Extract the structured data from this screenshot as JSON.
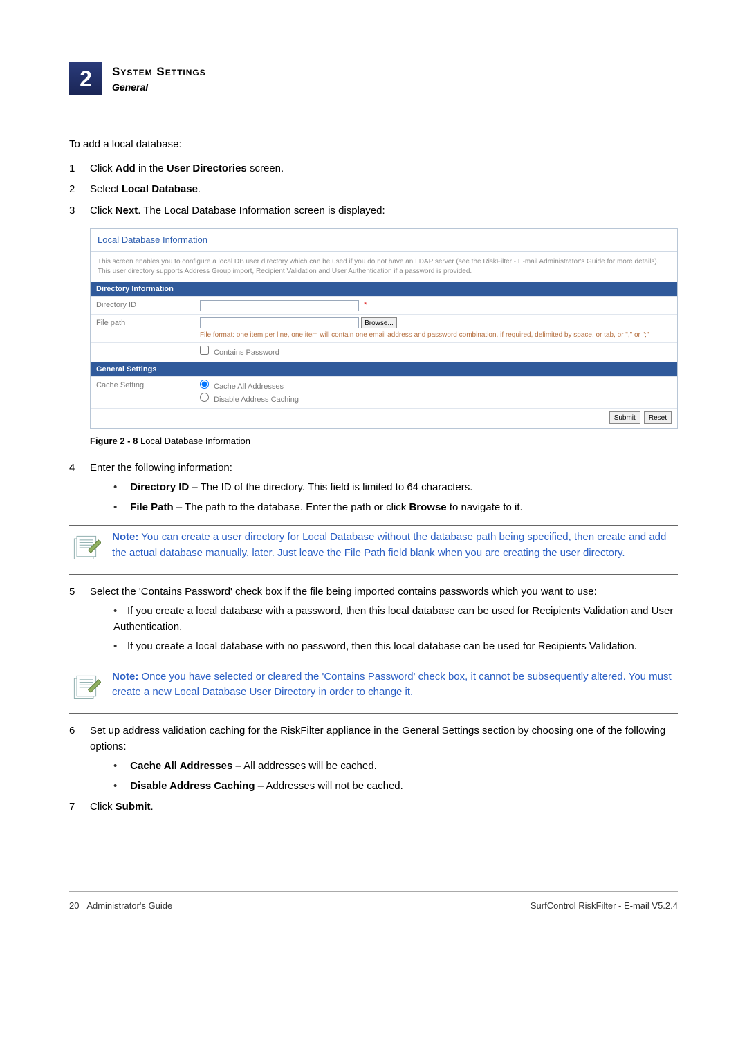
{
  "header": {
    "number": "2",
    "line1": "System Settings",
    "line2": "General"
  },
  "intro": "To add a local database:",
  "steps": {
    "s1": {
      "text_before": "Click ",
      "bold1": "Add",
      "mid": " in the ",
      "bold2": "User Directories",
      "after": " screen."
    },
    "s2": {
      "text_before": "Select ",
      "bold1": "Local Database",
      "after": "."
    },
    "s3": {
      "text_before": "Click ",
      "bold1": "Next",
      "after": ". The Local Database Information screen is displayed:"
    },
    "s4": {
      "text": "Enter the following information:"
    },
    "s5": {
      "text": "Select the 'Contains Password' check box if the file being imported contains passwords which you want to use:"
    },
    "s6": {
      "text": "Set up address validation caching for the RiskFilter appliance in the General Settings section by choosing one of the following options:"
    },
    "s7": {
      "text_before": "Click ",
      "bold1": "Submit",
      "after": "."
    }
  },
  "ldbi": {
    "title": "Local Database Information",
    "desc": "This screen enables you to configure a local DB user directory which can be used if you do not have an LDAP server (see the RiskFilter - E-mail Administrator's Guide for more details). This user directory supports Address Group import, Recipient Validation and User Authentication if a password is provided.",
    "section_dirinfo": "Directory Information",
    "directory_id_label": "Directory ID",
    "file_path_label": "File path",
    "browse_label": "Browse...",
    "file_format_hint": "File format: one item per line, one item will contain one email address and password combination, if required, delimited by space, or tab, or \",\" or \";\"",
    "contains_password_label": "Contains Password",
    "section_general": "General Settings",
    "cache_setting_label": "Cache Setting",
    "cache_all_label": "Cache All Addresses",
    "disable_caching_label": "Disable Address Caching",
    "submit_label": "Submit",
    "reset_label": "Reset"
  },
  "figure_caption": {
    "bold": "Figure 2 - 8",
    "rest": " Local Database Information"
  },
  "bullets_step4": {
    "b1": {
      "bold": "Directory ID",
      "rest": " – The ID of the directory. This field is limited to 64 characters."
    },
    "b2": {
      "bold": "File Path",
      "pre": " – The path to the database. Enter the path or click ",
      "bold2": "Browse",
      "post": " to navigate to it."
    }
  },
  "note1": {
    "label": "Note:",
    "text": "  You can create a user directory for Local Database without the database path being specified, then create and add the actual database manually, later. Just leave the File Path field blank when you are creating the user directory."
  },
  "bullets_step5": {
    "b1": "If you create a local database with a password, then this local database can be used for Recipients Validation and User Authentication.",
    "b2": "If you create a local database with no password, then this local database can be used for Recipients Validation."
  },
  "note2": {
    "label": "Note:",
    "text": "  Once you have selected or cleared the 'Contains Password' check box, it cannot be subsequently altered. You must create a new Local Database User Directory in order to change it."
  },
  "bullets_step6": {
    "b1": {
      "bold": "Cache All Addresses",
      "rest": " – All addresses will be cached."
    },
    "b2": {
      "bold": "Disable Address Caching",
      "rest": " – Addresses will not be cached."
    }
  },
  "footer": {
    "left_page": "20",
    "left_text": "Administrator's Guide",
    "right": "SurfControl RiskFilter - E-mail V5.2.4"
  }
}
